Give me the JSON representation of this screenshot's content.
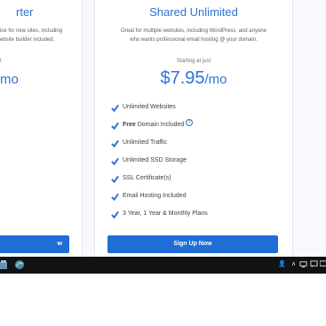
{
  "colors": {
    "accent": "#2a74d5",
    "button": "#1f6ed6",
    "taskbar": "#111214"
  },
  "left_card": {
    "title": "rter",
    "description_lines": [
      "ice for new sites, including",
      "ebsite builder included."
    ],
    "starting_text": "t",
    "price": "mo",
    "button_label": "w"
  },
  "right_card": {
    "title": "Shared Unlimited",
    "description_lines": [
      "Great for multiple websites, including WordPress, and anyone",
      "who wants professional email hosting @ your domain."
    ],
    "starting_text": "Starting at just",
    "price_amount": "$7.95",
    "price_unit": "/mo",
    "features": [
      {
        "text": "Unlimited Websites",
        "icon": "check-icon"
      },
      {
        "bold": "Free",
        "text": " Domain Included",
        "icon": "check-icon",
        "help_icon": "help-circle-icon",
        "help_glyph": "?"
      },
      {
        "text": "Unlimited Traffic",
        "icon": "check-icon"
      },
      {
        "text": "Unlimited SSD Storage",
        "icon": "check-icon"
      },
      {
        "text": "SSL Certificate(s)",
        "icon": "check-icon"
      },
      {
        "text": "Email Hosting Included",
        "icon": "check-icon"
      },
      {
        "text": "3 Year, 1 Year & Monthly Plans",
        "icon": "check-icon"
      }
    ],
    "button_label": "Sign Up Now"
  },
  "taskbar": {
    "apps": [
      "file-manager-icon",
      "browser-icon"
    ],
    "tray": [
      "people-icon",
      "chevron-up-icon",
      "network-icon",
      "chat-icon",
      "display-icon"
    ]
  }
}
